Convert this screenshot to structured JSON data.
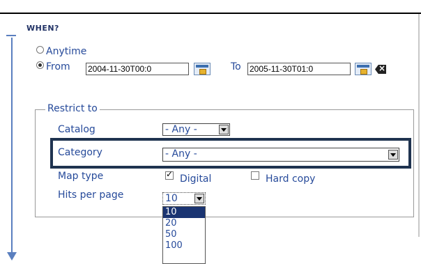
{
  "when": {
    "title": "WHEN?",
    "anytime_label": "Anytime",
    "from_label": "From",
    "from_value": "2004-11-30T00:0",
    "to_label": "To",
    "to_value": "2005-11-30T01:0"
  },
  "restrict": {
    "legend": "Restrict to",
    "catalog_label": "Catalog",
    "catalog_value": "- Any -",
    "category_label": "Category",
    "category_value": "- Any -",
    "maptype_label": "Map type",
    "digital_label": "Digital",
    "hardcopy_label": "Hard copy",
    "hits_label": "Hits per page",
    "hits_value": "10",
    "hits_options": [
      "10",
      "20",
      "50",
      "100"
    ]
  },
  "colors": {
    "label_blue": "#264a9a",
    "highlight_border": "#1f3350",
    "selected_bg": "#1a3472"
  }
}
